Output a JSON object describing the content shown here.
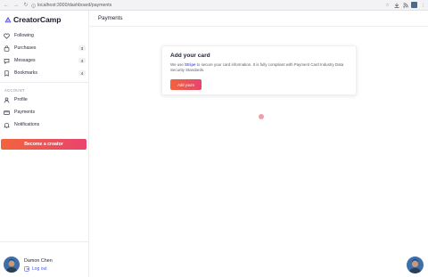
{
  "browser": {
    "url": "localhost:3000/dashboard/payments"
  },
  "brand": {
    "name": "CreatorCamp",
    "accent": "#e9436d",
    "accent_start": "#f2643c",
    "link_color": "#4f5fe6"
  },
  "sidebar": {
    "items": [
      {
        "label": "Following",
        "icon": "heart-icon"
      },
      {
        "label": "Purchases",
        "icon": "shopping-bag-icon",
        "badge": "3"
      },
      {
        "label": "Messages",
        "icon": "chat-bubble-icon",
        "badge": "4"
      },
      {
        "label": "Bookmarks",
        "icon": "bookmark-icon",
        "badge": "4"
      }
    ],
    "account_label": "ACCOUNT",
    "account_items": [
      {
        "label": "Profile",
        "icon": "user-icon"
      },
      {
        "label": "Payments",
        "icon": "credit-card-icon"
      },
      {
        "label": "Notifications",
        "icon": "bell-icon"
      }
    ],
    "creator_button": "Become a creator",
    "user": {
      "name": "Damon Chen",
      "logout": "Log out"
    }
  },
  "header": {
    "title": "Payments"
  },
  "card": {
    "title": "Add your card",
    "desc_prefix": "We use ",
    "desc_link": "Stripe",
    "desc_suffix": " to secure your card information. It is fully compliant with Payment Card Industry Data Security Standards.",
    "button": "Add yours"
  }
}
